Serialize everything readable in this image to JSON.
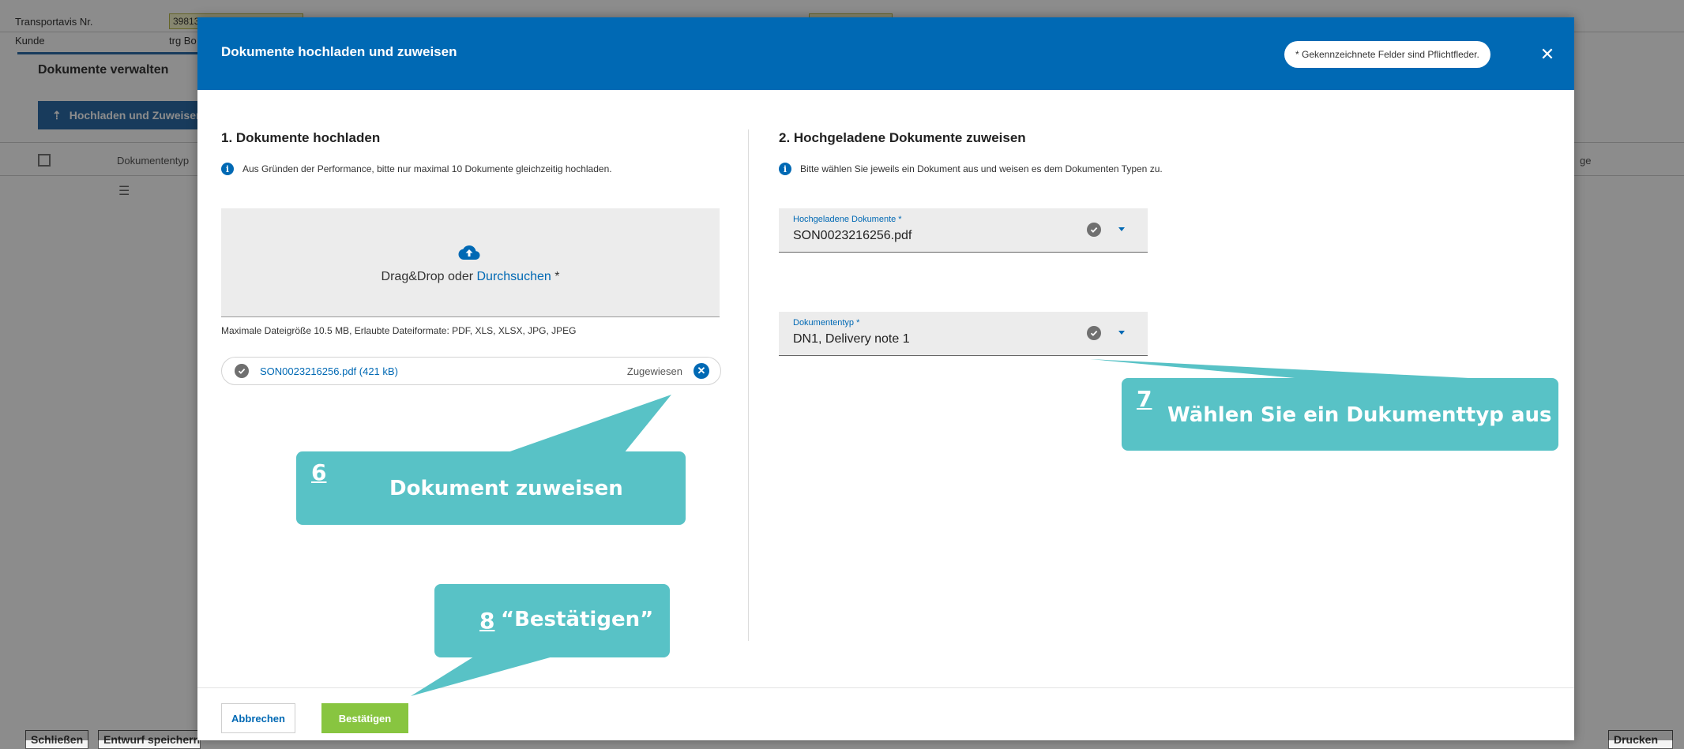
{
  "background": {
    "field1_label": "Transportavis Nr.",
    "field1_value": "39813",
    "field2_label": "Kunde",
    "field2_value": "trg Bo",
    "section_title": "Dokumente verwalten",
    "upload_button": "Hochladen und Zuweisen",
    "column_type": "Dokumententyp",
    "column_right": "ge",
    "footer_close": "Schließen",
    "footer_draft": "Entwurf speichern",
    "footer_print": "Drucken"
  },
  "modal": {
    "title": "Dokumente hochladen und zuweisen",
    "required_note": "* Gekennzeichnete Felder sind Pflichtfleder.",
    "close_glyph": "✕",
    "upload": {
      "title": "1. Dokumente hochladen",
      "info": "Aus Gründen der Performance, bitte nur maximal 10 Dokumente gleichzeitig hochladen.",
      "drop_text": "Drag&Drop oder ",
      "drop_link": "Durchsuchen",
      "drop_required": " *",
      "file_hint": "Maximale Dateigröße 10.5 MB, Erlaubte Dateiformate: PDF, XLS, XLSX, JPG, JPEG",
      "file_name": "SON0023216256.pdf (421 kB)",
      "file_status": "Zugewiesen"
    },
    "assign": {
      "title": "2. Hochgeladene Dokumente zuweisen",
      "info": "Bitte wählen Sie jeweils ein Dokument aus und weisen es dem Dokumenten Typen zu.",
      "uploaded_label": "Hochgeladene Dokumente *",
      "uploaded_value": "SON0023216256.pdf",
      "type_label": "Dokumententyp *",
      "type_value": "DN1, Delivery note 1"
    },
    "cancel_label": "Abbrechen",
    "confirm_label": "Bestätigen"
  },
  "callouts": {
    "step6_num": "6",
    "step6_text": "Dokument zuweisen",
    "step7_num": "7",
    "step7_text": "Wählen Sie ein Dukumenttyp aus",
    "step8_num": "8",
    "step8_text": "“Bestätigen”"
  },
  "colors": {
    "primary": "#0069b4",
    "confirm": "#88c540",
    "callout": "#58c2c6"
  }
}
